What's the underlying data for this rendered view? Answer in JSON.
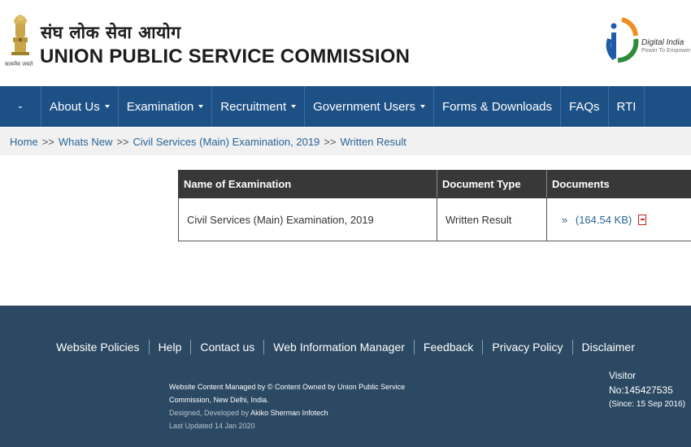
{
  "header": {
    "emblem_caption": "सत्यमेव जयते",
    "title_hindi": "संघ लोक सेवा आयोग",
    "title_english": "UNION PUBLIC SERVICE COMMISSION",
    "digital_india_name": "Digital India",
    "digital_india_tagline": "Power To Empower"
  },
  "nav": {
    "home_label": "-",
    "items": [
      {
        "label": "About Us",
        "dropdown": true
      },
      {
        "label": "Examination",
        "dropdown": true
      },
      {
        "label": "Recruitment",
        "dropdown": true
      },
      {
        "label": "Government Users",
        "dropdown": true
      },
      {
        "label": "Forms & Downloads",
        "dropdown": false
      },
      {
        "label": "FAQs",
        "dropdown": false
      },
      {
        "label": "RTI",
        "dropdown": false
      }
    ]
  },
  "breadcrumb": {
    "items": [
      "Home",
      "Whats New",
      "Civil Services (Main) Examination, 2019",
      "Written Result"
    ],
    "separator": ">>"
  },
  "table": {
    "headers": [
      "Name of Examination",
      "Document Type",
      "Documents"
    ],
    "rows": [
      {
        "name": "Civil Services (Main) Examination, 2019",
        "type": "Written Result",
        "doc_bullet": "»",
        "doc_size": "(164.54 KB)",
        "doc_icon": "pdf-icon"
      }
    ]
  },
  "footer": {
    "links": [
      "Website Policies",
      "Help",
      "Contact us",
      "Web Information Manager",
      "Feedback",
      "Privacy Policy",
      "Disclaimer"
    ],
    "content_managed": "Website Content Managed by © Content Owned by Union Public Service Commission, New Delhi, India.",
    "designed_prefix": "Designed, Developed by",
    "designed_by": "Akiko Sherman Infotech",
    "last_updated": "Last Updated 14 Jan 2020",
    "visitor_label": "Visitor",
    "visitor_count": "No:145427535",
    "visitor_since": "(Since: 15 Sep 2016)"
  },
  "colors": {
    "nav_bg": "#1d5186",
    "footer_bg": "#2b4962",
    "table_header_bg": "#383838",
    "link": "#2a6496"
  }
}
